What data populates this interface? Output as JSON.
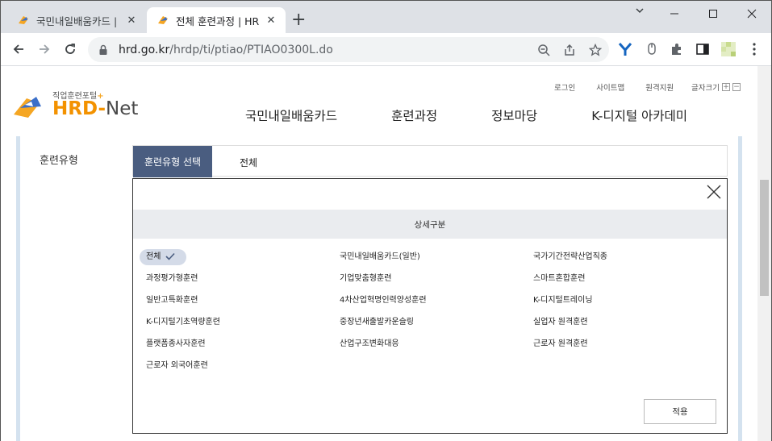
{
  "browser": {
    "tabs": [
      {
        "title": "국민내일배움카드 |",
        "active": false
      },
      {
        "title": "전체 훈련과정 | HR",
        "active": true
      }
    ],
    "url_host": "hrd.go.kr",
    "url_path": "/hrdp/ti/ptiao/PTIAO0300L.do"
  },
  "site": {
    "logo_tagline": "직업훈련포털",
    "logo_plus": "+",
    "logo_hrd": "HRD-",
    "logo_net": "Net",
    "utility": [
      "로그인",
      "사이트맵",
      "원격지원"
    ],
    "font_size_label": "글자크기",
    "font_plus": "+",
    "font_minus": "−",
    "nav": [
      "국민내일배움카드",
      "훈련과정",
      "정보마당",
      "K-디지털 아카데미"
    ]
  },
  "filter": {
    "label": "훈련유형",
    "select_button": "훈련유형 선택",
    "selected_value": "전체"
  },
  "popup": {
    "header": "상세구분",
    "options": [
      {
        "label": "전체",
        "selected": true
      },
      {
        "label": "국민내일배움카드(일반)",
        "selected": false
      },
      {
        "label": "국가기간전략산업직종",
        "selected": false
      },
      {
        "label": "과정평가형훈련",
        "selected": false
      },
      {
        "label": "기업맞춤형훈련",
        "selected": false
      },
      {
        "label": "스마트혼합훈련",
        "selected": false
      },
      {
        "label": "일반고특화훈련",
        "selected": false
      },
      {
        "label": "4차산업혁명인력양성훈련",
        "selected": false
      },
      {
        "label": "K-디지털트레이닝",
        "selected": false
      },
      {
        "label": "K-디지털기초역량훈련",
        "selected": false
      },
      {
        "label": "중장년새출발카운슬링",
        "selected": false
      },
      {
        "label": "실업자 원격훈련",
        "selected": false
      },
      {
        "label": "플랫폼종사자훈련",
        "selected": false
      },
      {
        "label": "산업구조변화대응",
        "selected": false
      },
      {
        "label": "근로자 원격훈련",
        "selected": false
      },
      {
        "label": "근로자 외국어훈련",
        "selected": false
      }
    ],
    "apply_label": "적용"
  },
  "colors": {
    "tabbar": "#dee1e6",
    "select_button_bg": "#4a5d80",
    "selected_chip_bg": "#d4dbe8",
    "popup_header_bg": "#eaecef",
    "brand_orange": "#f39200"
  }
}
